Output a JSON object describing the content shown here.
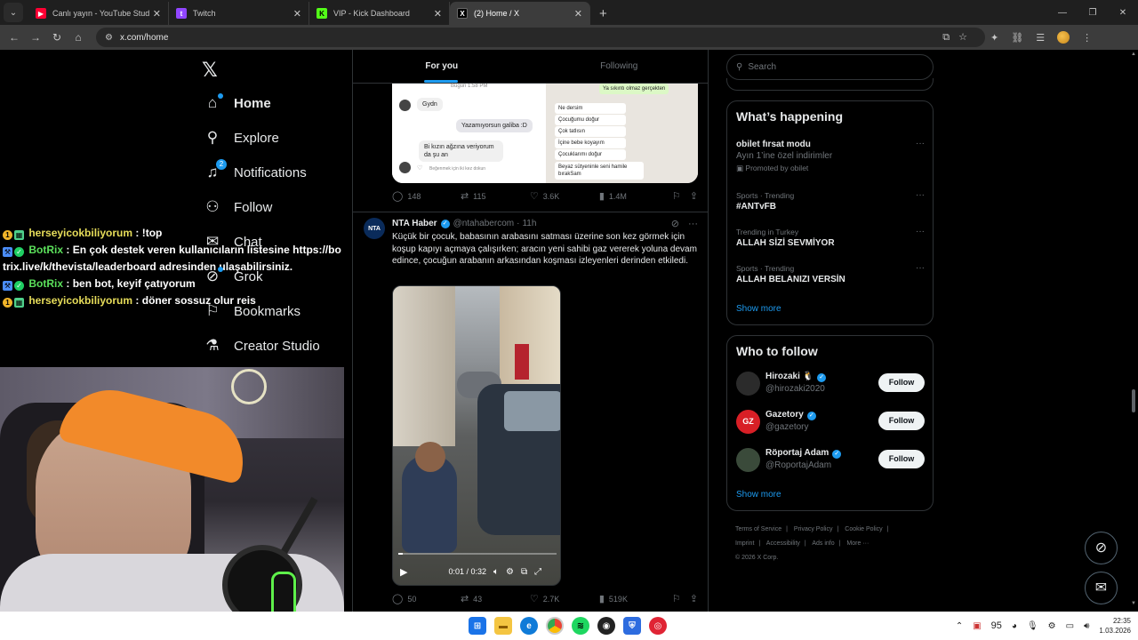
{
  "browser": {
    "tabs": [
      {
        "title": "Canlı yayın - YouTube Studio",
        "icon": "youtube-icon",
        "color": "#ff0033",
        "active": false
      },
      {
        "title": "Twitch",
        "icon": "twitch-icon",
        "color": "#9146ff",
        "active": false
      },
      {
        "title": "VIP - Kick Dashboard",
        "icon": "kick-icon",
        "color": "#53fc18",
        "active": false
      },
      {
        "title": "(2) Home / X",
        "icon": "x-icon",
        "color": "#000000",
        "active": true
      }
    ],
    "url": "x.com/home"
  },
  "stream_chat": [
    {
      "user": "herseyicokbiliyorum",
      "message": ": !top",
      "color": "#e7dd5a",
      "badges": [
        "gold",
        "green"
      ]
    },
    {
      "user": "BotRix",
      "message": ": En çok destek veren kullanıcıların listesine https://botrix.live/k/thevista/leaderboard adresinden ulaşabilirsiniz.",
      "color": "#5be05b",
      "badges": [
        "blue",
        "check"
      ]
    },
    {
      "user": "BotRix",
      "message": ": ben bot, keyif çatıyorum",
      "color": "#5be05b",
      "badges": [
        "blue",
        "check"
      ]
    },
    {
      "user": "herseyicokbiliyorum",
      "message": ": döner sossuz olur reis",
      "color": "#e7dd5a",
      "badges": [
        "gold",
        "green"
      ]
    }
  ],
  "nav": {
    "items": [
      {
        "label": "Home",
        "icon": "home-icon"
      },
      {
        "label": "Explore",
        "icon": "search-icon"
      },
      {
        "label": "Notifications",
        "icon": "bell-icon",
        "badge": "2"
      },
      {
        "label": "Follow",
        "icon": "add-person-icon"
      },
      {
        "label": "Chat",
        "icon": "mail-icon"
      },
      {
        "label": "Grok",
        "icon": "grok-icon"
      },
      {
        "label": "Bookmarks",
        "icon": "bookmark-icon"
      },
      {
        "label": "Creator Studio",
        "icon": "flask-icon"
      }
    ]
  },
  "timeline": {
    "tabs": [
      "For you",
      "Following"
    ],
    "prev_tweet": {
      "screenshot_texts": {
        "date": "Bugün 1:58 PM",
        "left": [
          "Gydn",
          "Yazamıyorsun galiba :D",
          "Bi kızın ağzına veriyorum da şu an",
          "Beğenmek için iki kez dokun"
        ],
        "right": [
          "Ya sıkıntı olmaz gerçekten",
          "Ne dersim",
          "Çocuğumu doğur",
          "Çok tatlısın",
          "İçine bebe koyayım",
          "Çocuklarımı doğur",
          "Beyaz sütyeninle seni hamile bırakSam"
        ]
      },
      "stats": {
        "replies": "148",
        "reposts": "115",
        "likes": "3.6K",
        "views": "1.4M"
      }
    },
    "tweet": {
      "author": "NTA Haber",
      "avatar_text": "NTA",
      "handle": "@ntahabercom",
      "time": "11h",
      "text": "Küçük bir çocuk, babasının arabasını satması üzerine son kez görmek için koşup kapıyı açmaya çalışırken; aracın yeni sahibi gaz vererek yoluna devam edince, çocuğun arabanın arkasından koşması izleyenleri derinden etkiledi.",
      "video": {
        "time": "0:01 / 0:32",
        "progress": 0.03
      },
      "stats": {
        "replies": "50",
        "reposts": "43",
        "likes": "2.7K",
        "views": "519K"
      }
    }
  },
  "sidebar": {
    "search_placeholder": "Search",
    "trends_title": "What’s happening",
    "trends": [
      {
        "meta": "",
        "name": "obilet fırsat modu",
        "sub": "Ayın 1’ine özel indirimler",
        "promo": "Promoted by obilet"
      },
      {
        "meta": "Sports · Trending",
        "name": "#ANTvFB",
        "sub": "",
        "promo": ""
      },
      {
        "meta": "Trending in Turkey",
        "name": "ALLAH SİZİ SEVMİYOR",
        "sub": "",
        "promo": ""
      },
      {
        "meta": "Sports · Trending",
        "name": "ALLAH BELANIZI VERSİN",
        "sub": "",
        "promo": ""
      }
    ],
    "show_more": "Show more",
    "who_title": "Who to follow",
    "who": [
      {
        "name": "Hirozaki 🐧",
        "handle": "@hirozaki2020",
        "avatar_color": "#2b2b2b",
        "button": "Follow"
      },
      {
        "name": "Gazetory",
        "handle": "@gazetory",
        "avatar_color": "#d81f26",
        "avatar_text": "GZ",
        "button": "Follow"
      },
      {
        "name": "Röportaj Adam",
        "handle": "@RoportajAdam",
        "avatar_color": "#3a4a3a",
        "button": "Follow"
      }
    ],
    "footer": [
      "Terms of Service",
      "Privacy Policy",
      "Cookie Policy",
      "Imprint",
      "Accessibility",
      "Ads info",
      "More ···",
      "© 2026 X Corp."
    ]
  },
  "taskbar": {
    "temperature": "95",
    "time": "22:35",
    "date": "1.03.2026"
  }
}
